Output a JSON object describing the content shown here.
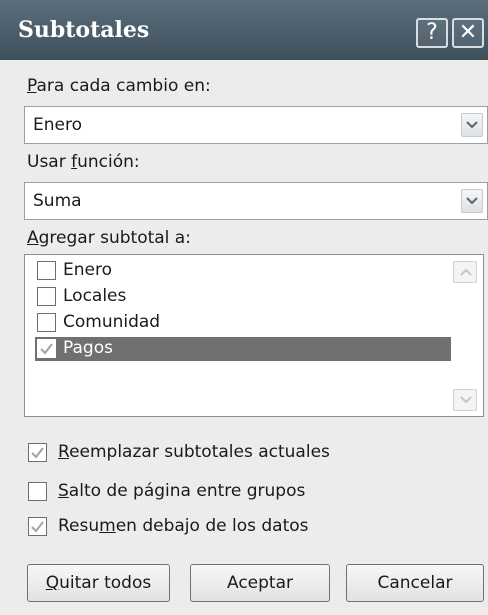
{
  "window": {
    "title": "Subtotales",
    "help_glyph": "?",
    "close_glyph": "✕"
  },
  "change_field": {
    "label_underlined": "P",
    "label_rest": "ara cada cambio en:",
    "value": "Enero"
  },
  "function_field": {
    "label_before": "Usar ",
    "label_underlined": "f",
    "label_rest": "unción:",
    "value": "Suma"
  },
  "subtotal_list": {
    "label_underlined": "A",
    "label_rest": "gregar subtotal a:",
    "items": [
      {
        "label": "Enero",
        "checked": false,
        "selected": false
      },
      {
        "label": "Locales",
        "checked": false,
        "selected": false
      },
      {
        "label": "Comunidad",
        "checked": false,
        "selected": false
      },
      {
        "label": "Pagos",
        "checked": true,
        "selected": true
      }
    ]
  },
  "options": [
    {
      "label_before": "",
      "label_underlined": "R",
      "label_rest": "eemplazar subtotales actuales",
      "checked": true
    },
    {
      "label_before": "",
      "label_underlined": "S",
      "label_rest": "alto de página entre grupos",
      "checked": false
    },
    {
      "label_before": "Resu",
      "label_underlined": "m",
      "label_rest": "en debajo de los datos",
      "checked": true
    }
  ],
  "buttons": {
    "remove_all_underlined": "Q",
    "remove_all_rest": "uitar todos",
    "accept": "Aceptar",
    "cancel": "Cancelar"
  },
  "colors": {
    "titlebar": "#4b5d6b",
    "selection": "#707070",
    "check": "#9aa4ad"
  }
}
